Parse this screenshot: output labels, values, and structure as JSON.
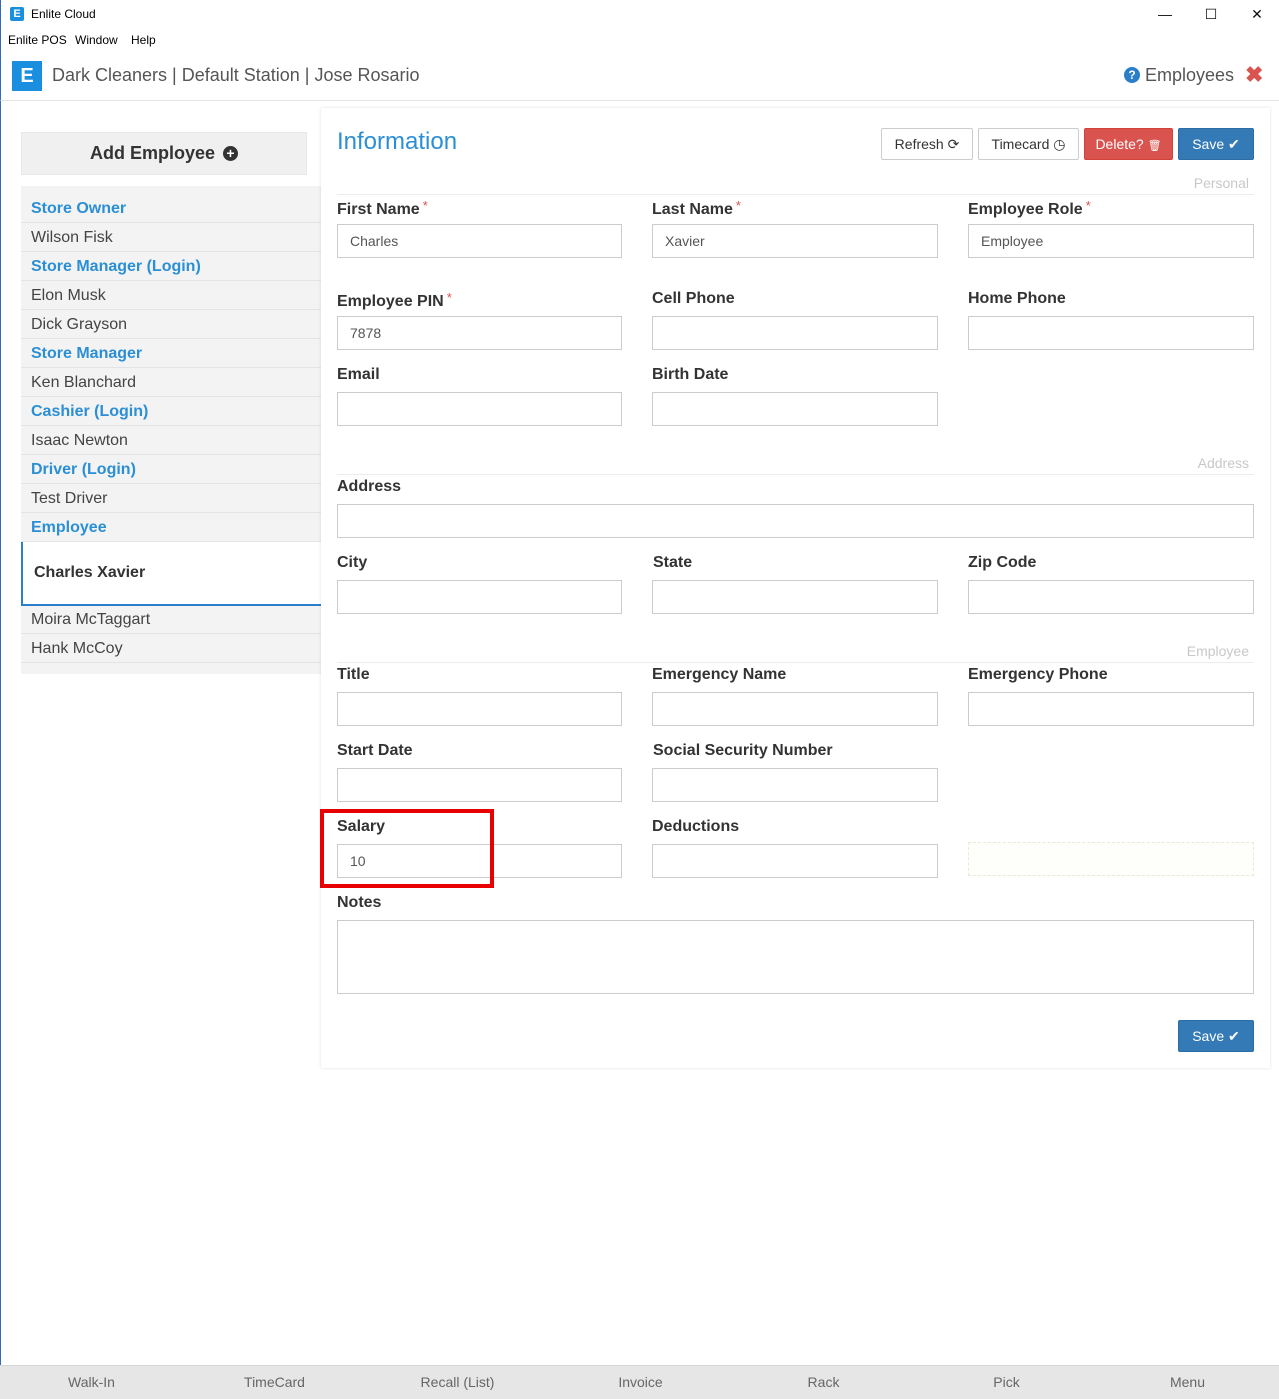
{
  "window": {
    "title": "Enlite Cloud",
    "app_icon": "E",
    "controls": [
      "—",
      "☐",
      "✕"
    ]
  },
  "menu": [
    "Enlite POS",
    "Window",
    "Help"
  ],
  "header": {
    "logo": "E",
    "breadcrumb": "Dark Cleaners | Default Station | Jose Rosario",
    "page_name": "Employees",
    "help_icon": "?",
    "close_icon": "✖"
  },
  "sidebar": {
    "add_employee_label": "Add Employee",
    "add_icon": "+",
    "items": [
      {
        "label": "Store Owner",
        "type": "group"
      },
      {
        "label": "Wilson Fisk",
        "type": "employee"
      },
      {
        "label": "Store Manager (Login)",
        "type": "group"
      },
      {
        "label": "Elon Musk",
        "type": "employee"
      },
      {
        "label": "Dick Grayson",
        "type": "employee"
      },
      {
        "label": "Store Manager",
        "type": "group"
      },
      {
        "label": "Ken Blanchard",
        "type": "employee"
      },
      {
        "label": "Cashier (Login)",
        "type": "group"
      },
      {
        "label": "Isaac Newton",
        "type": "employee"
      },
      {
        "label": "Driver (Login)",
        "type": "group"
      },
      {
        "label": "Test Driver",
        "type": "employee"
      },
      {
        "label": "Employee",
        "type": "group"
      },
      {
        "label": "Charles Xavier",
        "type": "selected"
      },
      {
        "label": "Moira McTaggart",
        "type": "employee"
      },
      {
        "label": "Hank McCoy",
        "type": "employee"
      }
    ]
  },
  "main": {
    "title": "Information",
    "buttons": {
      "refresh": "Refresh",
      "refresh_icon": "⟳",
      "timecard": "Timecard",
      "timecard_icon": "◷",
      "delete": "Delete?",
      "delete_icon": "🗑",
      "save": "Save",
      "save_icon": "✔"
    },
    "sections": {
      "personal": "Personal",
      "address": "Address",
      "employee": "Employee"
    },
    "fields": {
      "first_name": {
        "label": "First Name",
        "value": "Charles"
      },
      "last_name": {
        "label": "Last Name",
        "value": "Xavier"
      },
      "employee_role": {
        "label": "Employee Role",
        "value": "Employee"
      },
      "employee_pin": {
        "label": "Employee PIN",
        "value": "7878"
      },
      "cell_phone": {
        "label": "Cell Phone",
        "value": ""
      },
      "home_phone": {
        "label": "Home Phone",
        "value": ""
      },
      "email": {
        "label": "Email",
        "value": ""
      },
      "birth_date": {
        "label": "Birth Date",
        "value": ""
      },
      "address": {
        "label": "Address",
        "value": ""
      },
      "city": {
        "label": "City",
        "value": ""
      },
      "state": {
        "label": "State",
        "value": ""
      },
      "zip_code": {
        "label": "Zip Code",
        "value": ""
      },
      "title": {
        "label": "Title",
        "value": ""
      },
      "emergency_name": {
        "label": "Emergency Name",
        "value": ""
      },
      "emergency_phone": {
        "label": "Emergency Phone",
        "value": ""
      },
      "start_date": {
        "label": "Start Date",
        "value": ""
      },
      "ssn": {
        "label": "Social Security Number",
        "value": ""
      },
      "salary": {
        "label": "Salary",
        "value": "10"
      },
      "deductions": {
        "label": "Deductions",
        "value": ""
      },
      "notes": {
        "label": "Notes",
        "value": ""
      }
    },
    "required_marker": "*"
  },
  "bottom_bar": [
    "Walk-In",
    "TimeCard",
    "Recall (List)",
    "Invoice",
    "Rack",
    "Pick",
    "Menu"
  ],
  "colors": {
    "accent": "#2b8fd6",
    "primary": "#337ab7",
    "danger": "#d9534f",
    "highlight": "#e80000"
  }
}
